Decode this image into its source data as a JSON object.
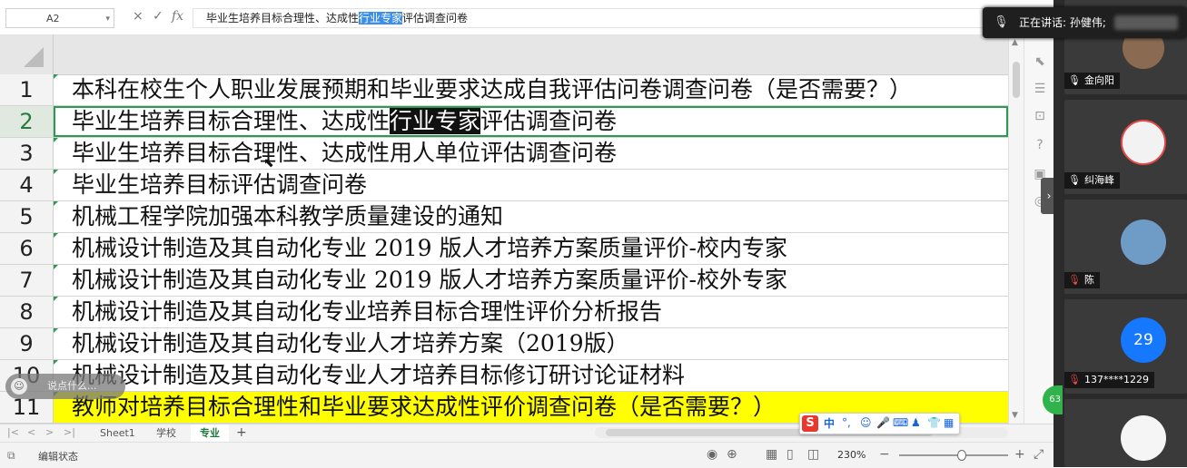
{
  "formula_bar": {
    "cell_ref": "A2",
    "formula_before": "毕业生培养目标合理性、达成性",
    "formula_selected": "行业专家",
    "formula_after": "评估调查问卷",
    "cancel_glyph": "×",
    "confirm_glyph": "✓",
    "fx_glyph": "fx"
  },
  "rows": [
    {
      "num": "1",
      "text": "本科在校生个人职业发展预期和毕业要求达成自我评估问卷调查问卷（是否需要？）"
    },
    {
      "num": "2",
      "before": "毕业生培养目标合理性、达成性",
      "highlight": "行业专家",
      "after": "评估调查问卷"
    },
    {
      "num": "3",
      "text": "毕业生培养目标合理性、达成性用人单位评估调查问卷"
    },
    {
      "num": "4",
      "text": "毕业生培养目标评估调查问卷"
    },
    {
      "num": "5",
      "text": "机械工程学院加强本科教学质量建设的通知"
    },
    {
      "num": "6",
      "text": "机械设计制造及其自动化专业 2019 版人才培养方案质量评价-校内专家"
    },
    {
      "num": "7",
      "text": "机械设计制造及其自动化专业 2019 版人才培养方案质量评价-校外专家"
    },
    {
      "num": "8",
      "text": "机械设计制造及其自动化专业培养目标合理性评价分析报告"
    },
    {
      "num": "9",
      "text": "机械设计制造及其自动化专业人才培养方案（2019版）"
    },
    {
      "num": "10",
      "text": "机械设计制造及其自动化专业人才培养目标修订研讨论证材料"
    },
    {
      "num": "11",
      "text": "教师对培养目标合理性和毕业要求达成性评价调查问卷（是否需要？）"
    }
  ],
  "sheet_tabs": [
    {
      "label": "Sheet1"
    },
    {
      "label": "学校"
    },
    {
      "label": "专业"
    }
  ],
  "add_sheet_glyph": "+",
  "status_bar": {
    "mode": "编辑状态",
    "zoom": "230%",
    "zoom_level_percent": 230
  },
  "meeting": {
    "speaking_label": "正在讲话: 孙健伟;",
    "participants": [
      {
        "name": "金向阳",
        "mic": "on"
      },
      {
        "name": "纠海峰",
        "mic": "on"
      },
      {
        "name": "陈",
        "mic": "off"
      },
      {
        "name": "137****1229",
        "mic": "off",
        "avatar_text": "29"
      },
      {
        "name": "",
        "mic": "none"
      }
    ]
  },
  "chat_placeholder": "说点什么...",
  "ime_toolbar": {
    "logo": "S",
    "mode": "中"
  },
  "green_badge": "63",
  "colors": {
    "active_green": "#2e9a4f",
    "row_yellow": "#ffff00",
    "selection_blue": "#3d8ee8",
    "avatar_blue": "#1677ff"
  }
}
